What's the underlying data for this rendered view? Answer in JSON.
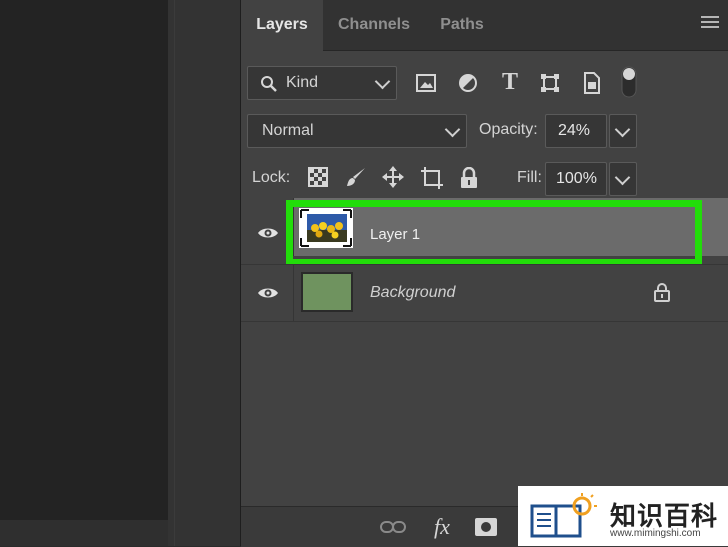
{
  "tabs": [
    {
      "label": "Layers",
      "active": true
    },
    {
      "label": "Channels",
      "active": false
    },
    {
      "label": "Paths",
      "active": false
    }
  ],
  "filter": {
    "kind_label": "Kind",
    "icons": [
      "image-filter-icon",
      "adjustment-filter-icon",
      "type-filter-icon",
      "shape-filter-icon",
      "smart-object-filter-icon",
      "filter-toggle-icon"
    ]
  },
  "blend": {
    "mode": "Normal",
    "opacity_label": "Opacity:",
    "opacity_value": "24%"
  },
  "lock": {
    "label": "Lock:",
    "icons": [
      "lock-transparent-pixels-icon",
      "lock-image-pixels-icon",
      "lock-position-icon",
      "lock-artboard-icon",
      "lock-all-icon"
    ],
    "fill_label": "Fill:",
    "fill_value": "100%"
  },
  "layers": [
    {
      "name": "Layer 1",
      "visible": true,
      "selected": true,
      "highlight_color": "#22dd0a"
    },
    {
      "name": "Background",
      "visible": true,
      "selected": false,
      "locked": true,
      "thumb_color": "#6f935f"
    }
  ],
  "bottom_icons": [
    "link-layers-icon",
    "fx-icon",
    "add-mask-icon"
  ],
  "watermark": {
    "title": "知识百科",
    "url": "www.mimingshi.com"
  },
  "colors": {
    "panel_bg": "#424242",
    "selected_row": "#6b6b6b",
    "highlight": "#22dd0a"
  }
}
